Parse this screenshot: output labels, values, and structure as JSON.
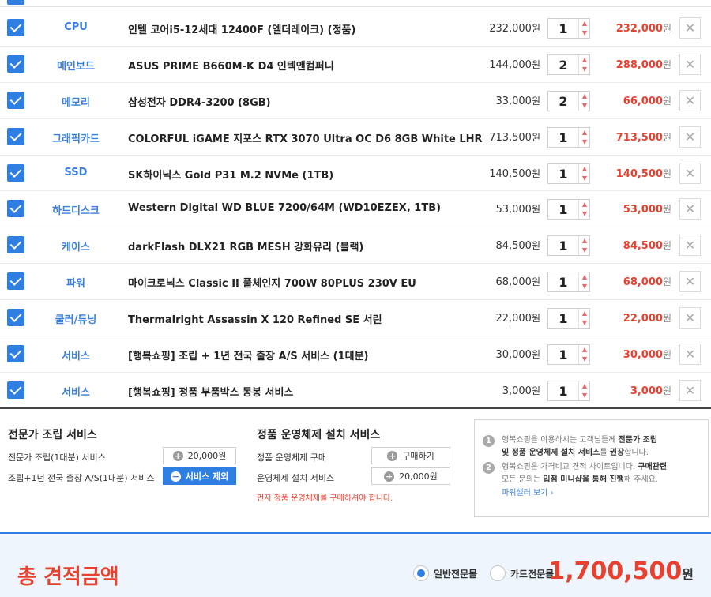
{
  "rows": [
    {
      "category": "CPU",
      "name": "인텔 코어i5-12세대 12400F (엘더레이크) (정품)",
      "unit_price": "232,000",
      "qty": "1",
      "total": "232,000"
    },
    {
      "category": "메인보드",
      "name": "ASUS PRIME B660M-K D4 인텍앤컴퍼니",
      "unit_price": "144,000",
      "qty": "2",
      "total": "288,000"
    },
    {
      "category": "메모리",
      "name": "삼성전자 DDR4-3200 (8GB)",
      "unit_price": "33,000",
      "qty": "2",
      "total": "66,000"
    },
    {
      "category": "그래픽카드",
      "name": "COLORFUL iGAME 지포스 RTX 3070 Ultra OC D6 8GB White LHR",
      "unit_price": "713,500",
      "qty": "1",
      "total": "713,500"
    },
    {
      "category": "SSD",
      "name": "SK하이닉스 Gold P31 M.2 NVMe (1TB)",
      "unit_price": "140,500",
      "qty": "1",
      "total": "140,500"
    },
    {
      "category": "하드디스크",
      "name": "Western Digital WD BLUE 7200/64M (WD10EZEX, 1TB)",
      "unit_price": "53,000",
      "qty": "1",
      "total": "53,000"
    },
    {
      "category": "케이스",
      "name": "darkFlash DLX21 RGB MESH 강화유리 (블랙)",
      "unit_price": "84,500",
      "qty": "1",
      "total": "84,500"
    },
    {
      "category": "파워",
      "name": "마이크로닉스 Classic II 풀체인지 700W 80PLUS 230V EU",
      "unit_price": "68,000",
      "qty": "1",
      "total": "68,000"
    },
    {
      "category": "쿨러/튜닝",
      "name": "Thermalright Assassin X 120 Refined SE 서린",
      "unit_price": "22,000",
      "qty": "1",
      "total": "22,000"
    },
    {
      "category": "서비스",
      "name": "[행복쇼핑] 조립 + 1년 전국 출장 A/S 서비스 (1대분)",
      "unit_price": "30,000",
      "qty": "1",
      "total": "30,000"
    },
    {
      "category": "서비스",
      "name": "[행복쇼핑] 정품 부품박스 동봉 서비스",
      "unit_price": "3,000",
      "qty": "1",
      "total": "3,000"
    }
  ],
  "currency": "원",
  "del_glyph": "✕",
  "assembly": {
    "title": "전문가 조립 서비스",
    "row1_label": "전문가 조립(1대분) 서비스",
    "row1_btn": "20,000원",
    "row2_label": "조립+1년 전국 출장 A/S(1대분) 서비스",
    "row2_btn": "서비스 제외"
  },
  "os": {
    "title": "정품 운영체제 설치 서비스",
    "row1_label": "정품 운영체제 구매",
    "row1_btn": "구매하기",
    "row2_label": "운영체제 설치 서비스",
    "row2_btn": "20,000원",
    "warning": "먼저 정품 운영체제를 구매하셔야 합니다."
  },
  "notice": {
    "n1": "1",
    "n1_a": "행복쇼핑을 이용하시는 고객님들께 ",
    "n1_b": "전문가 조립",
    "n1_c": "및 정품 운영체제 설치 서비스",
    "n1_d": "를 ",
    "n1_e": "권장",
    "n1_f": "합니다.",
    "n2": "2",
    "n2_a": "행복쇼핑은 가격비교 견적 사이트입니다. ",
    "n2_b": "구매관련",
    "n2_c": "모든 문의는 ",
    "n2_d": "입점 미니샵을 통해 진행",
    "n2_e": "해 주세요.",
    "link": "파워셀러 보기 ›"
  },
  "footer": {
    "title": "총 견적금액",
    "radio1": "일반전문몰",
    "radio2": "카드전문몰",
    "grand_total": "1,700,500",
    "grand_unit": "원"
  },
  "colors": {
    "accent": "#2f7ee2",
    "price_red": "#e8412f"
  }
}
